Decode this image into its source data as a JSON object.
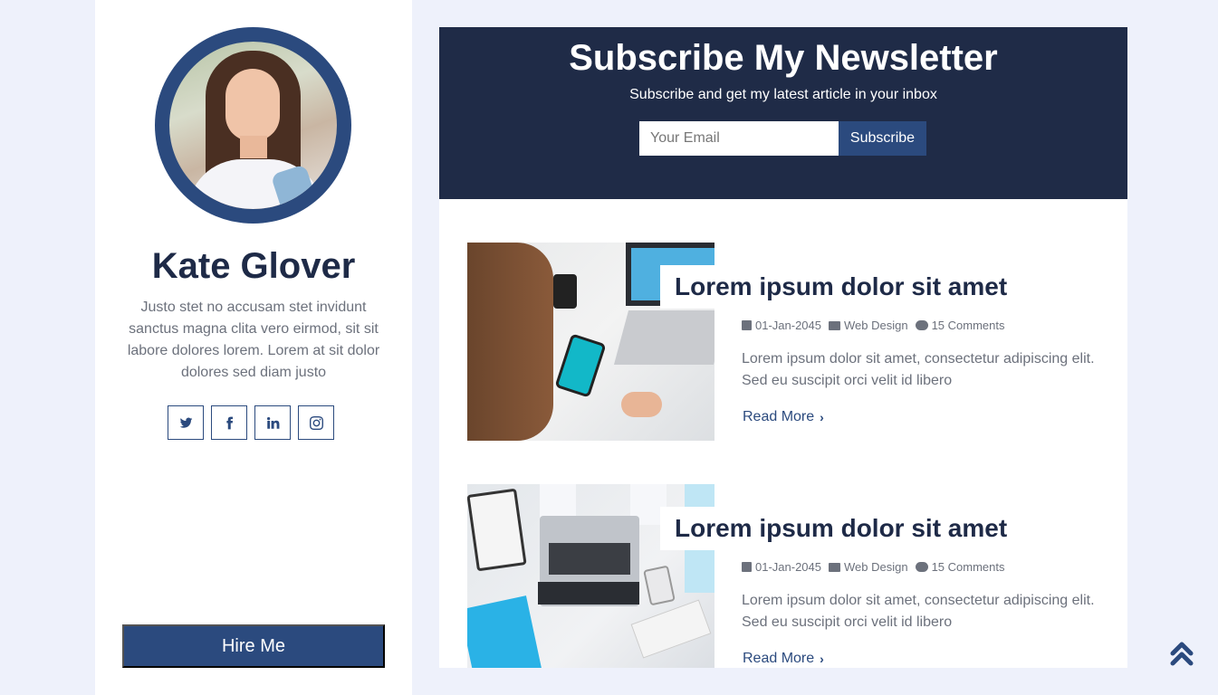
{
  "profile": {
    "name": "Kate Glover",
    "bio": "Justo stet no accusam stet invidunt sanctus magna clita vero eirmod, sit sit labore dolores lorem. Lorem at sit dolor dolores sed diam justo",
    "socials": [
      "twitter-icon",
      "facebook-icon",
      "linkedin-icon",
      "instagram-icon"
    ],
    "hire_label": "Hire Me"
  },
  "newsletter": {
    "title": "Subscribe My Newsletter",
    "subtitle": "Subscribe and get my latest article in your inbox",
    "email_placeholder": "Your Email",
    "button_label": "Subscribe"
  },
  "posts": [
    {
      "title": "Lorem ipsum dolor sit amet",
      "date": "01-Jan-2045",
      "category": "Web Design",
      "comments": "15 Comments",
      "excerpt": "Lorem ipsum dolor sit amet, consectetur adipiscing elit. Sed eu suscipit orci velit id libero",
      "read_more": "Read More"
    },
    {
      "title": "Lorem ipsum dolor sit amet",
      "date": "01-Jan-2045",
      "category": "Web Design",
      "comments": "15 Comments",
      "excerpt": "Lorem ipsum dolor sit amet, consectetur adipiscing elit. Sed eu suscipit orci velit id libero",
      "read_more": "Read More"
    }
  ],
  "colors": {
    "brand": "#2b4a7e",
    "dark": "#1f2b47",
    "page_bg": "#eef1fb"
  }
}
